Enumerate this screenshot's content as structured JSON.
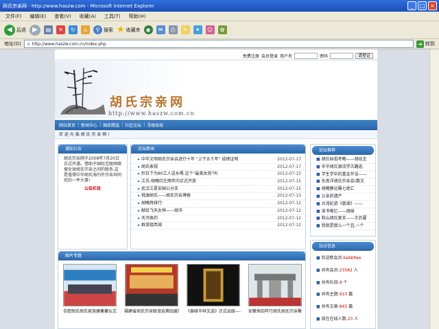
{
  "window": {
    "title": "网氏宗亲网 - http://www.haszw.com - Microsoft Internet Explorer"
  },
  "menu": [
    "文件(F)",
    "编辑(E)",
    "查看(V)",
    "收藏(A)",
    "工具(T)",
    "帮助(H)"
  ],
  "toolbar": {
    "back": "后退",
    "search": "搜索",
    "favorites": "收藏夹"
  },
  "address": {
    "label": "地址(D)",
    "value": "http://www.haszw.com.cn/index.php",
    "go": "转到"
  },
  "login": {
    "free_register": "免费注册",
    "member_login": "会员登录",
    "username_label": "用户名",
    "password_label": "密码",
    "submit": "请登证"
  },
  "site": {
    "logo_text": "胡氏宗亲网",
    "url_text": "http://www.haszw.com.cn"
  },
  "nav": [
    "网站首页",
    "新闻中心",
    "图库精选",
    "社区论坛",
    "寻根系统"
  ],
  "welcome": "欢 迎 光 临 胡 氏 宗 亲 网 !",
  "notice": {
    "title": "通知公告",
    "body": "胡氏宗亲网于2008年7月20日正式开通。借助于国际互联网络搜全球胡氏宗亲之间的联系,这是值得中华胡氏海内外宗亲共同欢的一件大事!",
    "signature": "公告栏目"
  },
  "news": {
    "title": "论坛新闻",
    "items": [
      {
        "title": "中华文明胡氏宗亲会进行十年 \"上下五千年\" 成绩证明",
        "date": "2012-07-17"
      },
      {
        "title": "胡氏家规",
        "date": "2012-07-17"
      },
      {
        "title": "烈日下为80工人送水喝 这个\"最美女孩\"叫",
        "date": "2012-07-15"
      },
      {
        "title": "江苏:胡曦红在雨年内正式开放",
        "date": "2012-07-15"
      },
      {
        "title": "武汉江夏安国公分支",
        "date": "2012-07-15"
      },
      {
        "title": "桃源胡氏——胡氏宗亲博客",
        "date": "2012-07-13"
      },
      {
        "title": "胡曦辉排行:",
        "date": "2012-07-12"
      },
      {
        "title": "献给飞天女神——胡洋",
        "date": "2012-07-12"
      },
      {
        "title": "天河表的",
        "date": "2012-07-12"
      },
      {
        "title": "群游接西湖",
        "date": "2012-07-12"
      }
    ]
  },
  "rank": {
    "title": "论坛推荐",
    "items": [
      "胡氏始祖考略——胡珪芝",
      "中华胡氏源流学古籍选",
      "学生学中的重金开设——",
      "东南洋胡氏宗亲会(散文",
      "胡曦静远蜀七绝汇",
      "父亲的遗产",
      "台湾纪游《慈湖》——",
      "读书唯忆——胡绰",
      "和山胡氏复支——王扔要",
      "我就是那么一个丑,一个"
    ]
  },
  "stats": {
    "title": "站点信息",
    "items": [
      {
        "label": "欢迎新会员:",
        "value": "bebbfwe"
      },
      {
        "label": "共有会员:",
        "value": "23582",
        "unit": "人"
      },
      {
        "label": "共有栏目:",
        "value": "9",
        "unit": "个"
      },
      {
        "label": "共有主题:",
        "value": "910",
        "unit": "篇"
      },
      {
        "label": "共有文章:",
        "value": "845",
        "unit": "篇"
      },
      {
        "label": "现在在线人数:",
        "value": "23",
        "unit": "人"
      }
    ]
  },
  "photos": {
    "title": "图片专题",
    "items": [
      {
        "caption": "合肥胡氏胡氏家族建襄襄仪式"
      },
      {
        "caption": "福建省胡氏宗亲联谊会第四届常务理事会"
      },
      {
        "caption": "《泰昧华祥文选》正式出版——"
      },
      {
        "caption": "安徽来四年行胡氏胡氏宗亲聚"
      }
    ]
  }
}
